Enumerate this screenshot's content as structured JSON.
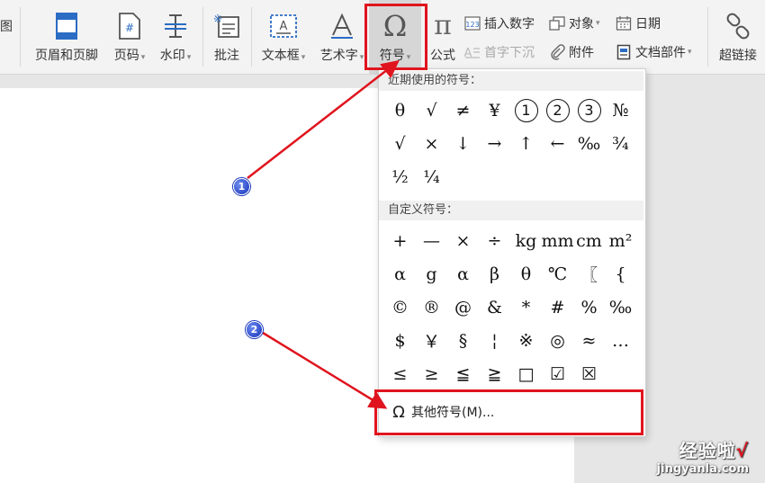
{
  "toolbar": {
    "partial_label": "图",
    "header_footer": "页眉和页脚",
    "page_number": "页码",
    "watermark": "水印",
    "comment": "批注",
    "textbox": "文本框",
    "wordart": "艺术字",
    "symbol": "符号",
    "formula": "公式",
    "insert_number": "插入数字",
    "drop_cap": "首字下沉",
    "object": "对象",
    "attachment": "附件",
    "date": "日期",
    "doc_parts": "文档部件",
    "hyperlink": "超链接"
  },
  "symbol_menu": {
    "recent_header": "近期使用的符号：",
    "recent": [
      "θ",
      "√",
      "≠",
      "¥",
      "1",
      "2",
      "3",
      "№",
      "√",
      "×",
      "↓",
      "→",
      "↑",
      "←",
      "‰",
      "¾",
      "½",
      "¼"
    ],
    "custom_header": "自定义符号：",
    "custom": [
      "+",
      "—",
      "×",
      "÷",
      "kg",
      "mm",
      "cm",
      "m²",
      "α",
      "g",
      "α",
      "β",
      "θ",
      "℃",
      "〖",
      "{",
      "©",
      "®",
      "@",
      "&",
      "*",
      "#",
      "%",
      "‰",
      "$",
      "￥",
      "§",
      "¦",
      "※",
      "◎",
      "≈",
      "…",
      "≤",
      "≥",
      "≦",
      "≧",
      "□",
      "☑",
      "☒"
    ],
    "more_label": "其他符号(M)..."
  },
  "annotations": {
    "badge1": "1",
    "badge2": "2"
  },
  "watermark": {
    "brand": "经验啦",
    "check": "√",
    "url": "jingyanla.com"
  },
  "colors": {
    "highlight": "#e0141e",
    "badge": "#1430b8"
  }
}
